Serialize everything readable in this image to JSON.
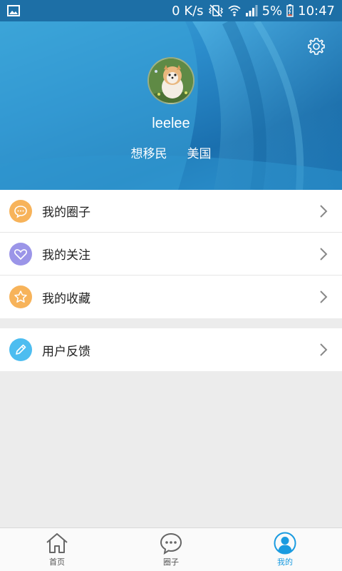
{
  "status_bar": {
    "speed": "0 K/s",
    "battery": "5%",
    "time": "10:47"
  },
  "profile": {
    "username": "leelee",
    "tags": [
      "想移民",
      "美国"
    ]
  },
  "menu": {
    "group1": [
      {
        "label": "我的圈子",
        "icon": "chat-bubble-icon",
        "color": "#f7b35a"
      },
      {
        "label": "我的关注",
        "icon": "heart-icon",
        "color": "#9b95e8"
      },
      {
        "label": "我的收藏",
        "icon": "star-icon",
        "color": "#f7b35a"
      }
    ],
    "group2": [
      {
        "label": "用户反馈",
        "icon": "pencil-icon",
        "color": "#4dbdf0"
      }
    ]
  },
  "tabs": [
    {
      "label": "首页",
      "icon": "home-icon"
    },
    {
      "label": "圈子",
      "icon": "chat-bubble-icon"
    },
    {
      "label": "我的",
      "icon": "user-icon",
      "active": true
    }
  ],
  "colors": {
    "accent": "#1a9be0",
    "hero": "#2b8ccb"
  }
}
